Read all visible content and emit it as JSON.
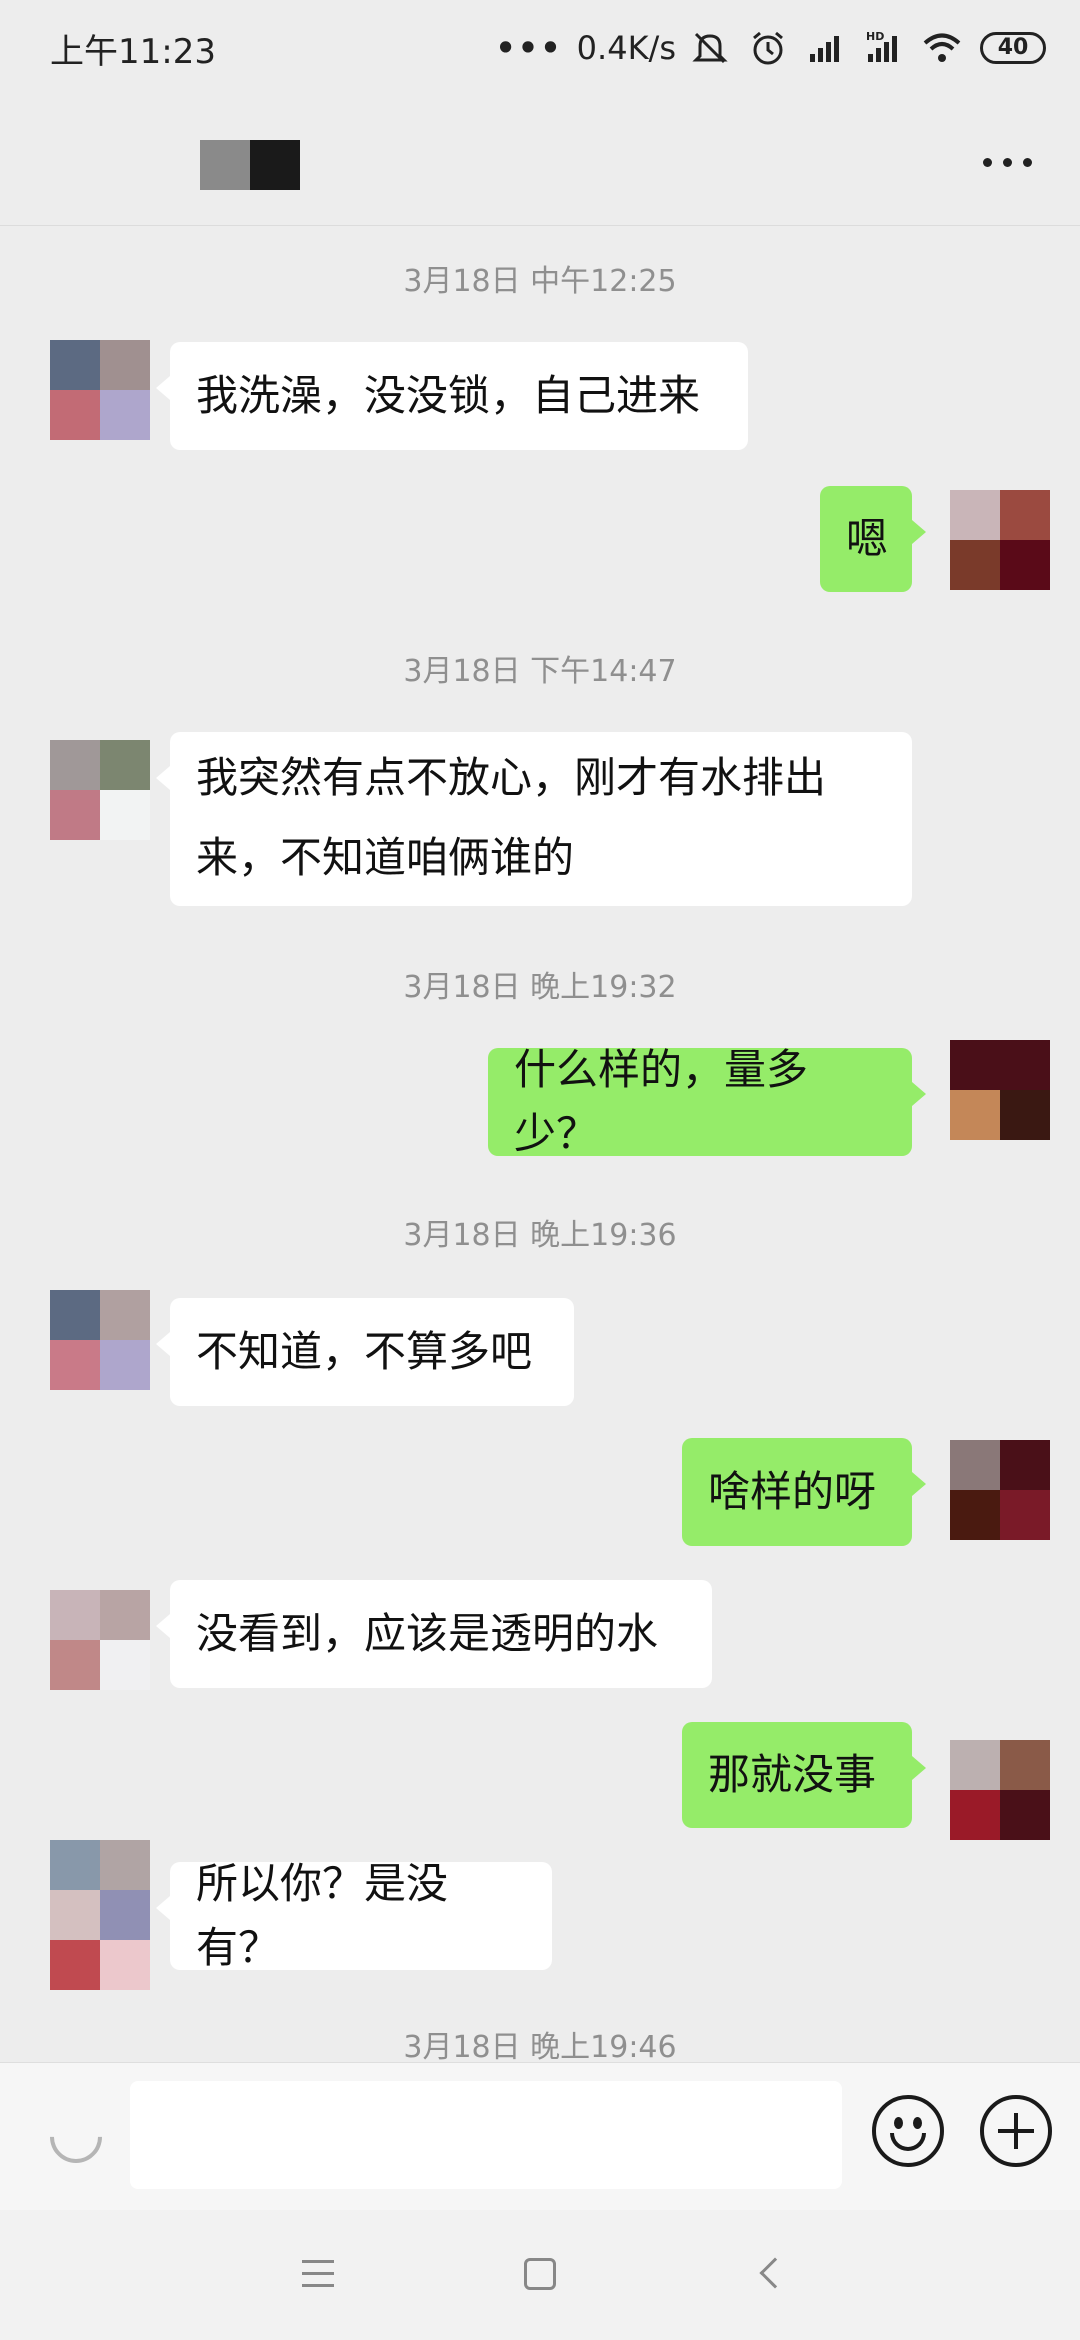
{
  "status_bar": {
    "time": "上午11:23",
    "network_speed": "0.4K/s",
    "battery": "40",
    "icons": [
      "dots-icon",
      "mute-icon",
      "alarm-icon",
      "signal-icon",
      "hd-signal-icon",
      "wifi-icon",
      "battery-icon"
    ]
  },
  "header": {
    "more_icon": "more-dots-icon",
    "avatar_colors": [
      "#8a8a8a",
      "#1a1a1a"
    ]
  },
  "messages": [
    {
      "type": "timestamp",
      "text": "3月18日 中午12:25"
    },
    {
      "type": "left",
      "text": "我洗澡，没没锁，自己进来",
      "avatar": [
        "#5c6a82",
        "#a09090",
        "#c26b75",
        "#aea6cc"
      ]
    },
    {
      "type": "right",
      "text": "嗯",
      "avatar": [
        "#c9b5b8",
        "#9b4a40",
        "#7a3a2a",
        "#5a0a18"
      ]
    },
    {
      "type": "timestamp",
      "text": "3月18日 下午14:47"
    },
    {
      "type": "left",
      "lines": [
        "我突然有点不放心，刚才有水排出",
        "来，不知道咱俩谁的"
      ],
      "avatar": [
        "#a09898",
        "#7c8670",
        "#c07a86",
        "#f2f3f3"
      ]
    },
    {
      "type": "timestamp",
      "text": "3月18日 晚上19:32"
    },
    {
      "type": "right",
      "text": "什么样的，量多少？",
      "avatar": [
        "#4a0f18",
        "#4a0f18",
        "#c48758",
        "#3a1812"
      ]
    },
    {
      "type": "timestamp",
      "text": "3月18日 晚上19:36"
    },
    {
      "type": "left",
      "text": "不知道，不算多吧",
      "avatar": [
        "#5c6a82",
        "#b0a0a0",
        "#c97a88",
        "#aea6cc"
      ]
    },
    {
      "type": "right",
      "text": "啥样的呀",
      "avatar": [
        "#8a7878",
        "#4a1018",
        "#4a1a10",
        "#7a1a28"
      ]
    },
    {
      "type": "left",
      "text": "没看到，应该是透明的水",
      "avatar": [
        "#c8b4b8",
        "#b8a4a4",
        "#c08888",
        "#f0f0f2"
      ]
    },
    {
      "type": "right",
      "text": "那就没事",
      "avatar": [
        "#bcb0b0",
        "#8a5a48",
        "#9a1a28",
        "#4a1018"
      ]
    },
    {
      "type": "left",
      "text": "所以你？是没有？",
      "avatar": [
        "#8898aa",
        "#b0a4a4",
        "#d4c0c0",
        "#9090b4",
        "#c04a50",
        "#ecc8cc"
      ]
    },
    {
      "type": "timestamp",
      "text": "3月18日 晚上19:46"
    }
  ],
  "input_bar": {
    "placeholder": "",
    "value": "",
    "voice_icon": "voice-icon",
    "emoji_icon": "emoji-icon",
    "plus_icon": "plus-icon"
  },
  "nav_bar": {
    "icons": [
      "menu-icon",
      "home-icon",
      "back-icon"
    ]
  }
}
